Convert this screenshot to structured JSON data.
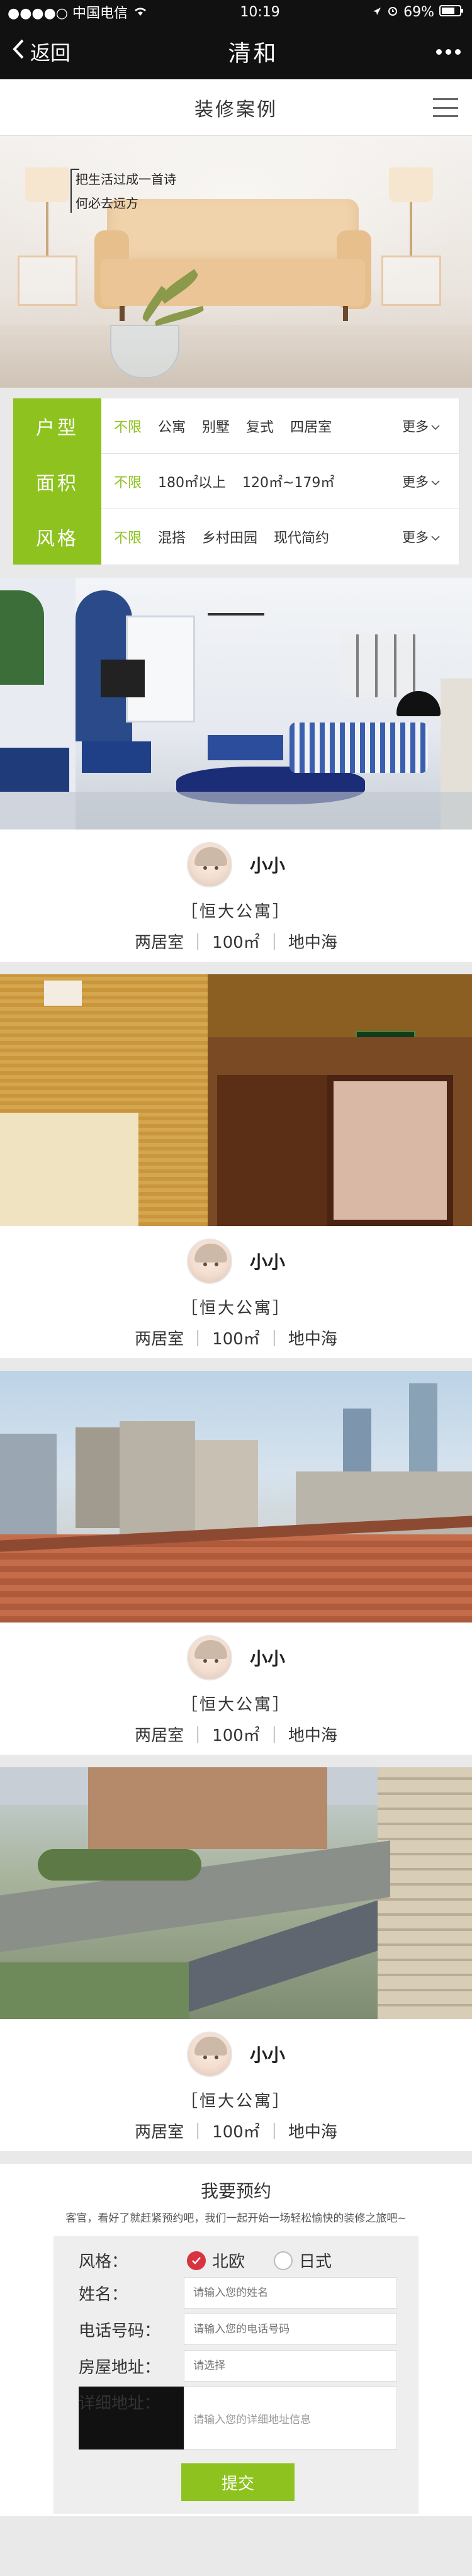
{
  "status_bar": {
    "carrier": "●●●●○ 中国电信",
    "time": "10:19",
    "battery": "69%"
  },
  "nav": {
    "back_label": "返回",
    "title": "清和"
  },
  "subheader": {
    "title": "装修案例"
  },
  "banner": {
    "line1": "把生活过成一首诗",
    "line2": "何必去远方"
  },
  "filters": [
    {
      "label": "户型",
      "options": [
        "不限",
        "公寓",
        "别墅",
        "复式",
        "四居室"
      ],
      "active": "不限",
      "more": "更多"
    },
    {
      "label": "面积",
      "options": [
        "不限",
        "180㎡以上",
        "120㎡~179㎡"
      ],
      "active": "不限",
      "more": "更多"
    },
    {
      "label": "风格",
      "options": [
        "不限",
        "混搭",
        "乡村田园",
        "现代简约"
      ],
      "active": "不限",
      "more": "更多"
    }
  ],
  "cases": [
    {
      "designer": "小小",
      "project": "［恒大公寓］",
      "layout": "两居室",
      "area": "100㎡",
      "style": "地中海"
    },
    {
      "designer": "小小",
      "project": "［恒大公寓］",
      "layout": "两居室",
      "area": "100㎡",
      "style": "地中海"
    },
    {
      "designer": "小小",
      "project": "［恒大公寓］",
      "layout": "两居室",
      "area": "100㎡",
      "style": "地中海"
    },
    {
      "designer": "小小",
      "project": "［恒大公寓］",
      "layout": "两居室",
      "area": "100㎡",
      "style": "地中海"
    }
  ],
  "booking": {
    "title": "我要预约",
    "intro": "客官，看好了就赶紧预约吧，我们一起开始一场轻松愉快的装修之旅吧~",
    "style_label": "风格：",
    "style_options": [
      "北欧",
      "日式"
    ],
    "style_selected": "北欧",
    "name_label": "姓名：",
    "name_placeholder": "请输入您的姓名",
    "phone_label": "电话号码：",
    "phone_placeholder": "请输入您的电话号码",
    "address_label": "房屋地址：",
    "address_placeholder": "请选择",
    "detail_label": "详细地址：",
    "detail_placeholder": "请输入您的详细地址信息",
    "submit_label": "提交"
  },
  "colors": {
    "accent": "#8dc21f",
    "radio_on": "#d8343f",
    "nav_bg": "#111111"
  }
}
